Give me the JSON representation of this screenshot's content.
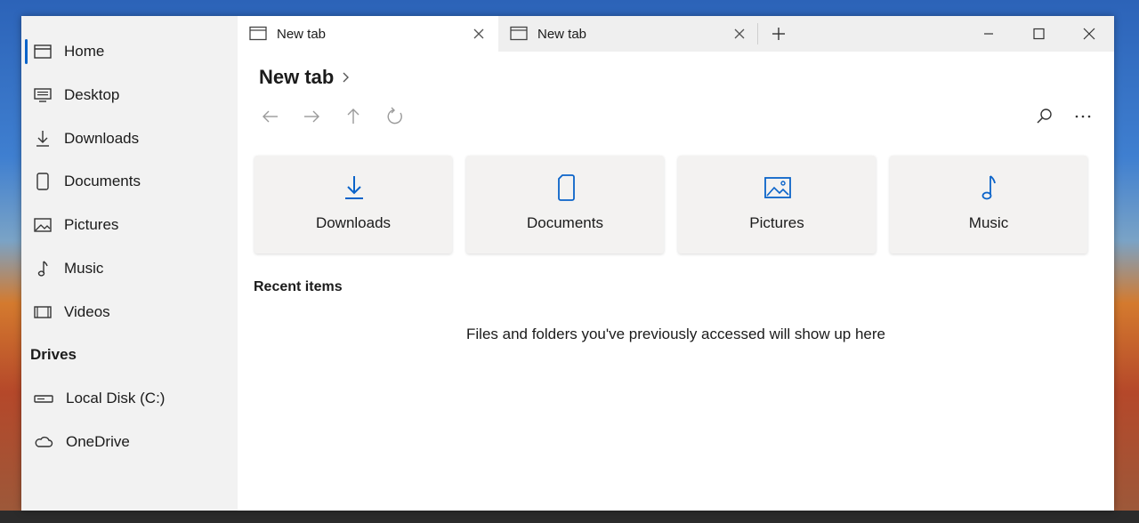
{
  "sidebar": {
    "items": [
      {
        "label": "Home",
        "icon": "home-icon"
      },
      {
        "label": "Desktop",
        "icon": "desktop-icon"
      },
      {
        "label": "Downloads",
        "icon": "download-icon"
      },
      {
        "label": "Documents",
        "icon": "document-icon"
      },
      {
        "label": "Pictures",
        "icon": "picture-icon"
      },
      {
        "label": "Music",
        "icon": "music-note-icon"
      },
      {
        "label": "Videos",
        "icon": "video-icon"
      }
    ],
    "drives_title": "Drives",
    "drives": [
      {
        "label": "Local Disk (C:)",
        "icon": "hard-drive-icon"
      },
      {
        "label": "OneDrive",
        "icon": "cloud-icon"
      }
    ]
  },
  "tabs": [
    {
      "label": "New tab"
    },
    {
      "label": "New tab"
    }
  ],
  "breadcrumb": {
    "title": "New tab"
  },
  "cards": [
    {
      "label": "Downloads",
      "icon": "download-icon"
    },
    {
      "label": "Documents",
      "icon": "document-icon"
    },
    {
      "label": "Pictures",
      "icon": "picture-icon"
    },
    {
      "label": "Music",
      "icon": "music-note-icon"
    }
  ],
  "recent": {
    "title": "Recent items",
    "empty_message": "Files and folders you've previously accessed will show up here"
  },
  "colors": {
    "accent": "#0a63c9",
    "sidebar_bg": "#f2f2f2",
    "card_bg": "#f3f2f1"
  }
}
